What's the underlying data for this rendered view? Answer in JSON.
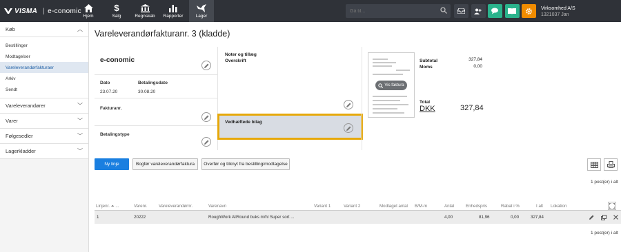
{
  "brand": {
    "visma": "VISMA",
    "sep": "|",
    "product": "e-conomic"
  },
  "nav": [
    {
      "label": "Hjem",
      "icon": "home-icon"
    },
    {
      "label": "Salg",
      "icon": "dollar-icon"
    },
    {
      "label": "Regnskab",
      "icon": "bank-icon"
    },
    {
      "label": "Rapporter",
      "icon": "bar-chart-icon"
    },
    {
      "label": "Lager",
      "icon": "bird-icon",
      "active": true
    }
  ],
  "search": {
    "placeholder": "Gå til..."
  },
  "top_icons": [
    "inbox-icon",
    "users-icon",
    "chat-icon",
    "book-icon",
    "gear-icon"
  ],
  "company": {
    "name": "Virksomhed A/S",
    "id_user": "1321037 Jan"
  },
  "sidebar": {
    "kob": {
      "label": "Køb",
      "items": [
        "Bestillinger",
        "Modtagelser",
        "Vareleverandørfakturaer",
        "Arkiv",
        "Sendt"
      ],
      "active": "Vareleverandørfakturaer"
    },
    "sections": [
      "Vareleverandører",
      "Varer",
      "Følgesedler",
      "Lagerkladder"
    ]
  },
  "page": {
    "title": "Vareleverandørfakturanr. 3 (kladde)"
  },
  "supplier": {
    "name": "e-conomic",
    "date_label": "Dato",
    "date_value": "23.07.20",
    "due_label": "Betalingsdato",
    "due_value": "30.08.20",
    "invoice_no_label": "Fakturanr.",
    "payment_type_label": "Betalingstype"
  },
  "notes": {
    "line1": "Noter og tillæg",
    "line2": "Overskrift"
  },
  "attachments": {
    "label": "Vedhæftede bilag"
  },
  "preview": {
    "button": "Vis faktura"
  },
  "totals": {
    "subtotal_label": "Subtotal",
    "subtotal_value": "327,84",
    "vat_label": "Moms",
    "vat_value": "0,00",
    "total_label": "Total",
    "currency": "DKK",
    "total_value": "327,84"
  },
  "actions": {
    "new_line": "Ny linje",
    "book": "Bogfør vareleverandørfaktura",
    "transfer": "Overfør og tilknyt fra bestilling/modtagelse"
  },
  "count_text": "1 post(er) i alt",
  "table": {
    "headers": [
      "Linjenr. ⏶ ...",
      "Varenr.",
      "Vareleverandørnr.",
      "Varenavn",
      "Variant 1",
      "Variant 2",
      "Modtaget antal",
      "B/M-m",
      "Antal",
      "Enhedspris",
      "Rabat i %",
      "I alt",
      "Lokation"
    ],
    "rows": [
      [
        "1",
        "20222",
        "",
        "RoughWork AllRound buks m/hl Super sort ...",
        "",
        "",
        "",
        "",
        "4,00",
        "81,96",
        "0,00",
        "327,84",
        ""
      ]
    ]
  },
  "colors": {
    "topbar": "#2f3238",
    "accent_green": "#2bb38c",
    "accent_orange": "#f08c00",
    "primary": "#1a7fe0",
    "highlight": "#e6a80a"
  }
}
